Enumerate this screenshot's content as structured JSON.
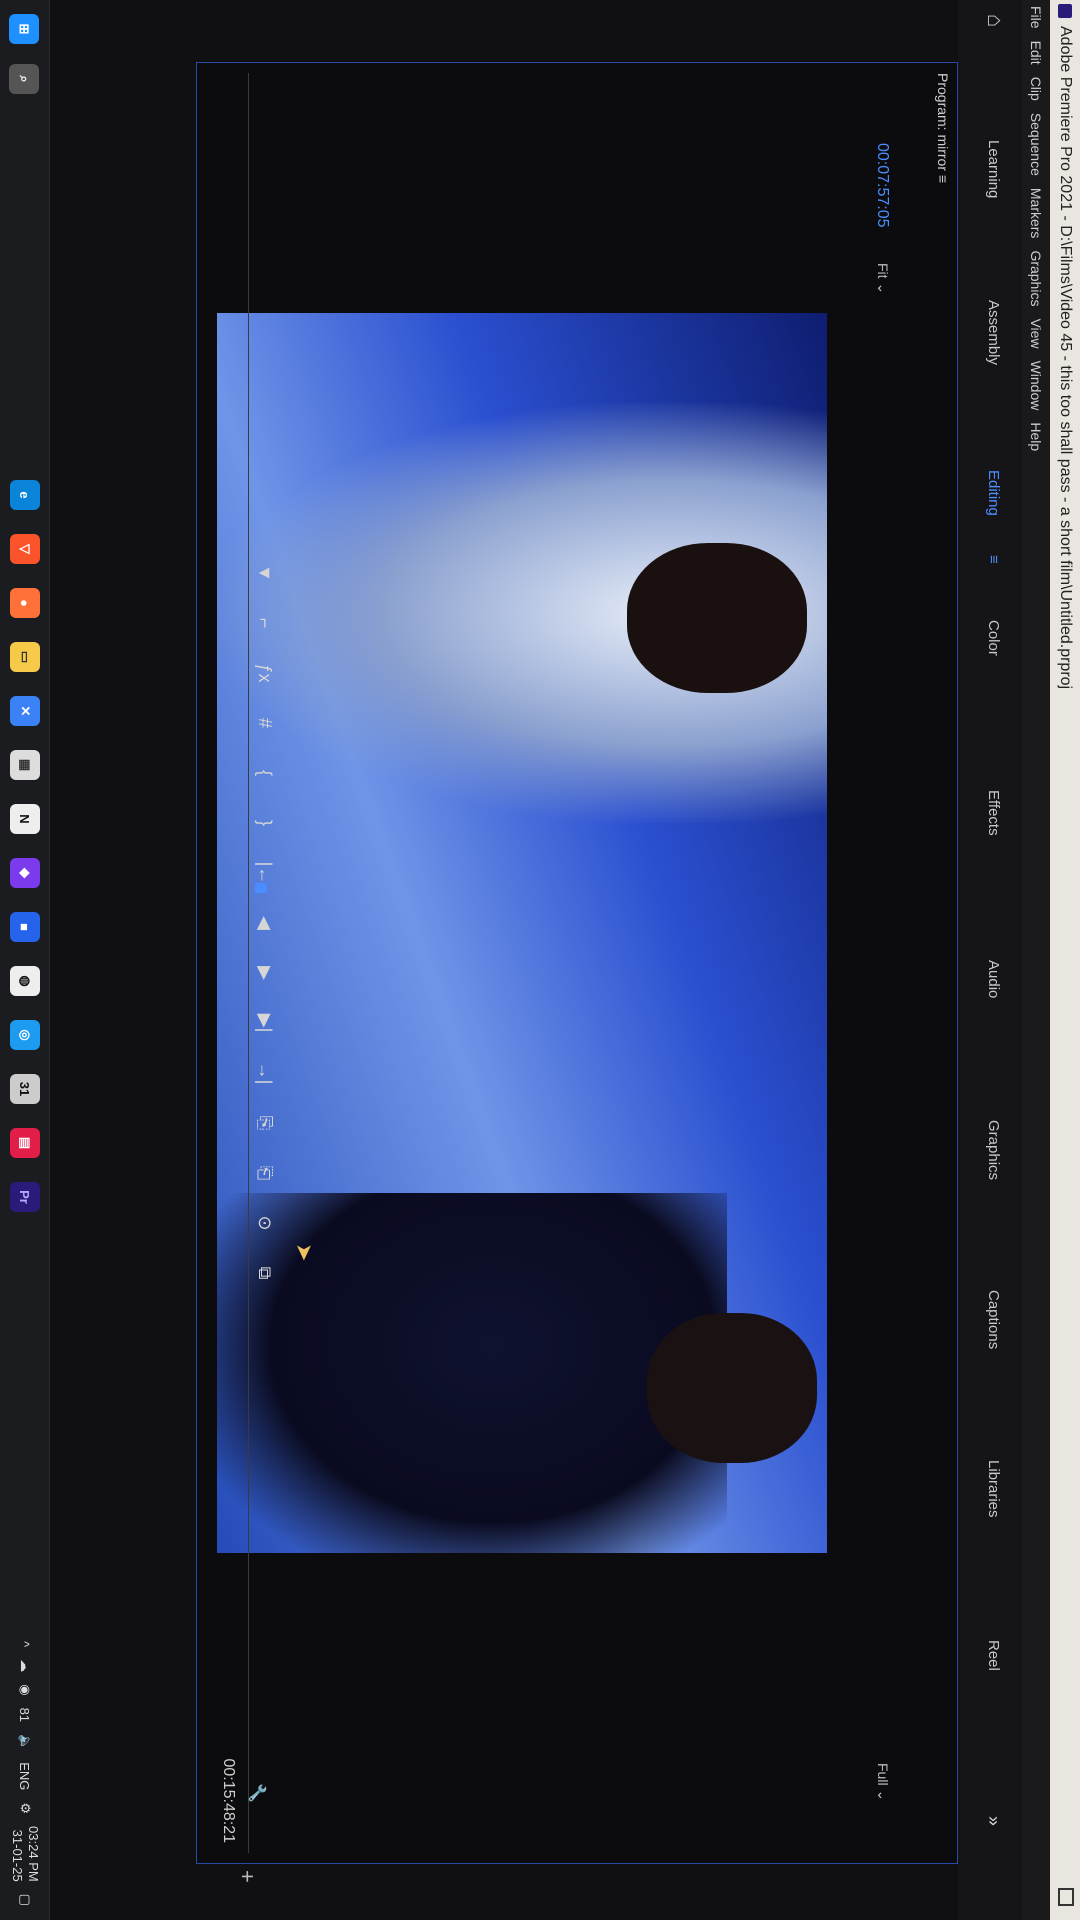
{
  "titlebar": {
    "title": "Adobe Premiere Pro 2021 - D:\\Films\\Video 45 - this too shall pass - a short film\\Untitled.prproj"
  },
  "menu": [
    "File",
    "Edit",
    "Clip",
    "Sequence",
    "Markers",
    "Graphics",
    "View",
    "Window",
    "Help"
  ],
  "workspaces": {
    "items": [
      "Learning",
      "Assembly",
      "Editing",
      "Color",
      "Effects",
      "Audio",
      "Graphics",
      "Captions",
      "Libraries",
      "Reel"
    ],
    "active": "Editing",
    "more_icon": "chevron-double-right"
  },
  "program_monitor": {
    "tab_label": "Program: mirror",
    "timecode_current": "00:07:57:05",
    "fit": "Fit",
    "resolution": "Full",
    "timecode_duration": "00:15:48:21"
  },
  "controls": [
    "add-marker",
    "mark-in",
    "mark-out",
    "go-to-in",
    "step-back",
    "play",
    "step-forward",
    "go-to-out",
    "lift",
    "extract",
    "export-frame",
    "comparison-view"
  ],
  "controls_glyphs": [
    "▼",
    "⌐",
    "ƒx",
    "#",
    "{",
    "}",
    "|←",
    "◀",
    "▶",
    "▶|",
    "→|",
    "⎘",
    "⎗",
    "⊙",
    "⧉"
  ],
  "taskbar": {
    "tray": {
      "notification_count": "81",
      "language": "ENG",
      "time": "03:24 PM",
      "date": "31-01-25"
    },
    "pinned_apps": [
      "Edge",
      "Brave",
      "Firefox",
      "File Explorer",
      "Teams",
      "Microsoft Store",
      "Notion",
      "Obsidian",
      "App",
      "Opera",
      "Safari",
      "Calendar",
      "PDF",
      "Pr"
    ]
  },
  "colors": {
    "accent": "#4b8dff",
    "titlebar": "#e9e6e0",
    "panel_border": "#2b4aa8"
  }
}
